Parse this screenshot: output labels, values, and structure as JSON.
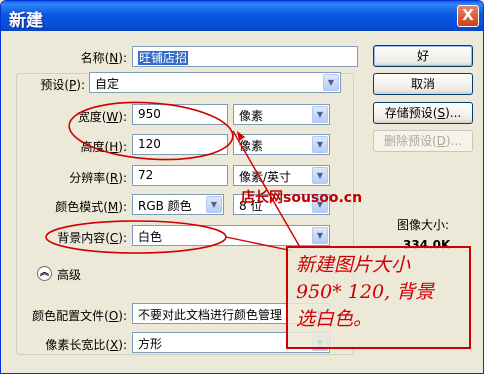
{
  "window": {
    "title": "新建",
    "close_label": "X"
  },
  "form": {
    "name": {
      "label": "名称(",
      "key": "N",
      "suffix": "):",
      "value": "旺铺店招"
    },
    "preset": {
      "label": "预设(",
      "key": "P",
      "suffix": "):",
      "value": "自定"
    },
    "width": {
      "label": "宽度(",
      "key": "W",
      "suffix": "):",
      "value": "950",
      "unit": "像素"
    },
    "height": {
      "label": "高度(",
      "key": "H",
      "suffix": "):",
      "value": "120",
      "unit": "像素"
    },
    "resolution": {
      "label": "分辨率(",
      "key": "R",
      "suffix": "):",
      "value": "72",
      "unit": "像素/英寸"
    },
    "color_mode": {
      "label": "颜色模式(",
      "key": "M",
      "suffix": "):",
      "value": "RGB 颜色",
      "depth": "8 位"
    },
    "background": {
      "label": "背景内容(",
      "key": "C",
      "suffix": "):",
      "value": "白色"
    },
    "advanced_label": "高级",
    "color_profile": {
      "label": "颜色配置文件(",
      "key": "O",
      "suffix": "):",
      "value": "不要对此文档进行颜色管理"
    },
    "pixel_aspect": {
      "label": "像素长宽比(",
      "key": "X",
      "suffix": "):",
      "value": "方形"
    }
  },
  "buttons": {
    "ok": "好",
    "cancel": "取消",
    "save_preset": {
      "text": "存储预设(",
      "key": "S",
      "suffix": ")..."
    },
    "delete_preset": {
      "text": "删除预设(",
      "key": "D",
      "suffix": ")..."
    }
  },
  "image_size": {
    "label": "图像大小:",
    "value": "334.0K"
  },
  "annotation": {
    "watermark": "店长网sousoo.cn",
    "note_lines": [
      "新建图片大小",
      "950* 120, 背景",
      "选白色。"
    ],
    "color": "#d00000"
  },
  "colors": {
    "titlebar": "#0a58e0",
    "dialog_bg": "#ece9d8",
    "selection": "#316ac5",
    "annotation_red": "#d00000"
  }
}
